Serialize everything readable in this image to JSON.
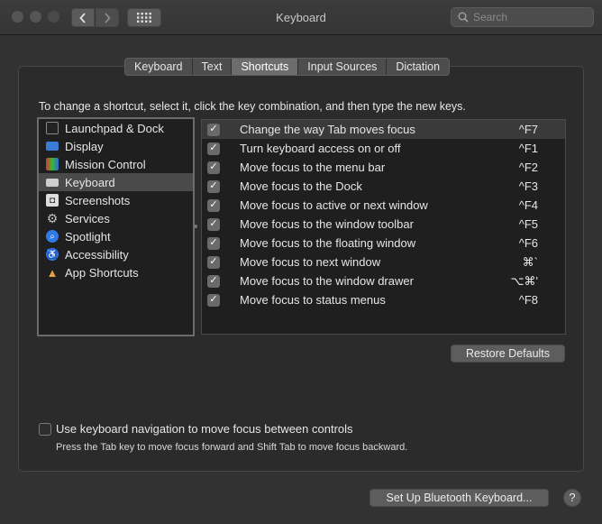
{
  "window": {
    "title": "Keyboard"
  },
  "search": {
    "placeholder": "Search"
  },
  "tabs": [
    {
      "label": "Keyboard"
    },
    {
      "label": "Text"
    },
    {
      "label": "Shortcuts",
      "active": true
    },
    {
      "label": "Input Sources"
    },
    {
      "label": "Dictation"
    }
  ],
  "instruction": "To change a shortcut, select it, click the key combination, and then type the new keys.",
  "categories": [
    {
      "label": "Launchpad & Dock",
      "icon": "launchpad-dock-icon"
    },
    {
      "label": "Display",
      "icon": "display-icon"
    },
    {
      "label": "Mission Control",
      "icon": "mission-control-icon"
    },
    {
      "label": "Keyboard",
      "icon": "keyboard-icon",
      "selected": true
    },
    {
      "label": "Screenshots",
      "icon": "screenshots-icon"
    },
    {
      "label": "Services",
      "icon": "gear-icon"
    },
    {
      "label": "Spotlight",
      "icon": "spotlight-search-icon"
    },
    {
      "label": "Accessibility",
      "icon": "accessibility-icon"
    },
    {
      "label": "App Shortcuts",
      "icon": "app-shortcuts-icon"
    }
  ],
  "shortcuts": [
    {
      "label": "Change the way Tab moves focus",
      "keys": "^F7",
      "checked": true
    },
    {
      "label": "Turn keyboard access on or off",
      "keys": "^F1",
      "checked": true
    },
    {
      "label": "Move focus to the menu bar",
      "keys": "^F2",
      "checked": true
    },
    {
      "label": "Move focus to the Dock",
      "keys": "^F3",
      "checked": true
    },
    {
      "label": "Move focus to active or next window",
      "keys": "^F4",
      "checked": true
    },
    {
      "label": "Move focus to the window toolbar",
      "keys": "^F5",
      "checked": true
    },
    {
      "label": "Move focus to the floating window",
      "keys": "^F6",
      "checked": true
    },
    {
      "label": "Move focus to next window",
      "keys": "⌘`",
      "checked": true
    },
    {
      "label": "Move focus to the window drawer",
      "keys": "⌥⌘'",
      "checked": true
    },
    {
      "label": "Move focus to status menus",
      "keys": "^F8",
      "checked": true
    }
  ],
  "buttons": {
    "restore_defaults": "Restore Defaults",
    "bluetooth": "Set Up Bluetooth Keyboard...",
    "help": "?"
  },
  "keyboard_navigation": {
    "label": "Use keyboard navigation to move focus between controls",
    "hint": "Press the Tab key to move focus forward and Shift Tab to move focus backward.",
    "checked": false
  }
}
